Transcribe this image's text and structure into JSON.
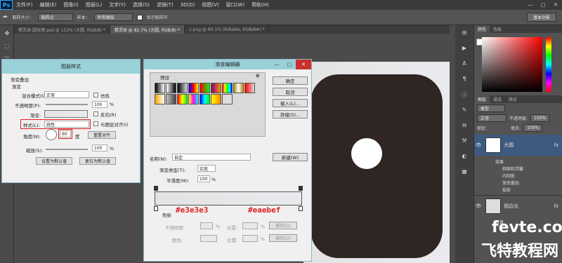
{
  "app": {
    "logo": "Ps"
  },
  "menu": [
    "文件(F)",
    "编辑(E)",
    "图像(I)",
    "图层(L)",
    "文字(Y)",
    "选择(S)",
    "滤镜(T)",
    "3D(D)",
    "视图(V)",
    "窗口(W)",
    "帮助(H)"
  ],
  "window_controls": [
    "—",
    "□",
    "✕"
  ],
  "options_bar": {
    "sample_size_label": "取样大小：",
    "sample_size_value": "取样点",
    "sample_label": "样本：",
    "sample_value": "所有图层",
    "show_ring_label": "显示取样环",
    "workspace": "基本功能"
  },
  "doc_tabs": [
    {
      "label": "精灵球-超纹理.psd @ 153% (大圆, RGB/8) *",
      "active": false
    },
    {
      "label": "精灵球 @ 82.7% (大圆, RGB/8) *",
      "active": true
    },
    {
      "label": "1.png @ 90.1% (Rdlable, RGB/8#) *",
      "active": false
    }
  ],
  "color_panel": {
    "tabs": [
      "颜色",
      "色板"
    ]
  },
  "layers_panel": {
    "tabs": [
      "图层",
      "通道",
      "路径"
    ],
    "kind_label": "类型",
    "blend_mode": "正常",
    "opacity_label": "不透明度:",
    "opacity_value": "100%",
    "lock_label": "锁定:",
    "fill_label": "填充:",
    "fill_value": "100%",
    "layer1_name": "大圆",
    "effects_label": "效果",
    "effect_items": [
      "斜面和浮雕",
      "内阴影",
      "渐变叠加",
      "投影"
    ],
    "layer2_name": "倒边光",
    "fx": "fx"
  },
  "layer_style": {
    "title": "图层样式",
    "section": "渐变叠加",
    "group": "渐变",
    "blend_mode_label": "混合模式(O):",
    "blend_mode_value": "正常",
    "dither_label": "仿色",
    "opacity_label": "不透明度(P):",
    "opacity_value": "100",
    "percent": "%",
    "gradient_label": "渐变:",
    "reverse_label": "反向(R)",
    "style_label": "样式(L):",
    "style_value": "线性",
    "align_label": "与图层对齐(I)",
    "angle_label": "角度(N):",
    "angle_value": "60",
    "degree": "度",
    "reset_align_btn": "重置对齐",
    "scale_label": "缩放(S):",
    "scale_value": "100",
    "default_btn": "设置为默认值",
    "reset_default_btn": "复位为默认值"
  },
  "gradient_editor": {
    "title": "渐变编辑器",
    "presets_label": "预设",
    "ok": "确定",
    "cancel": "取消",
    "load": "载入(L)...",
    "save": "存储(S)...",
    "name_label": "名称(N):",
    "name_value": "自定",
    "new_btn": "新建(W)",
    "type_label": "渐变类型(T):",
    "type_value": "实底",
    "smooth_label": "平滑度(M):",
    "smooth_value": "100",
    "percent": "%",
    "stops_label": "色标",
    "opacity_label": "不透明度:",
    "location_label": "位置:",
    "delete_btn": "删除(D)",
    "color_label": "颜色:"
  },
  "annotations": {
    "left_color": "#e3e3e3",
    "right_color": "#eaebef"
  },
  "watermark": {
    "line1": "fevte.com",
    "line2": "飞特教程网"
  }
}
